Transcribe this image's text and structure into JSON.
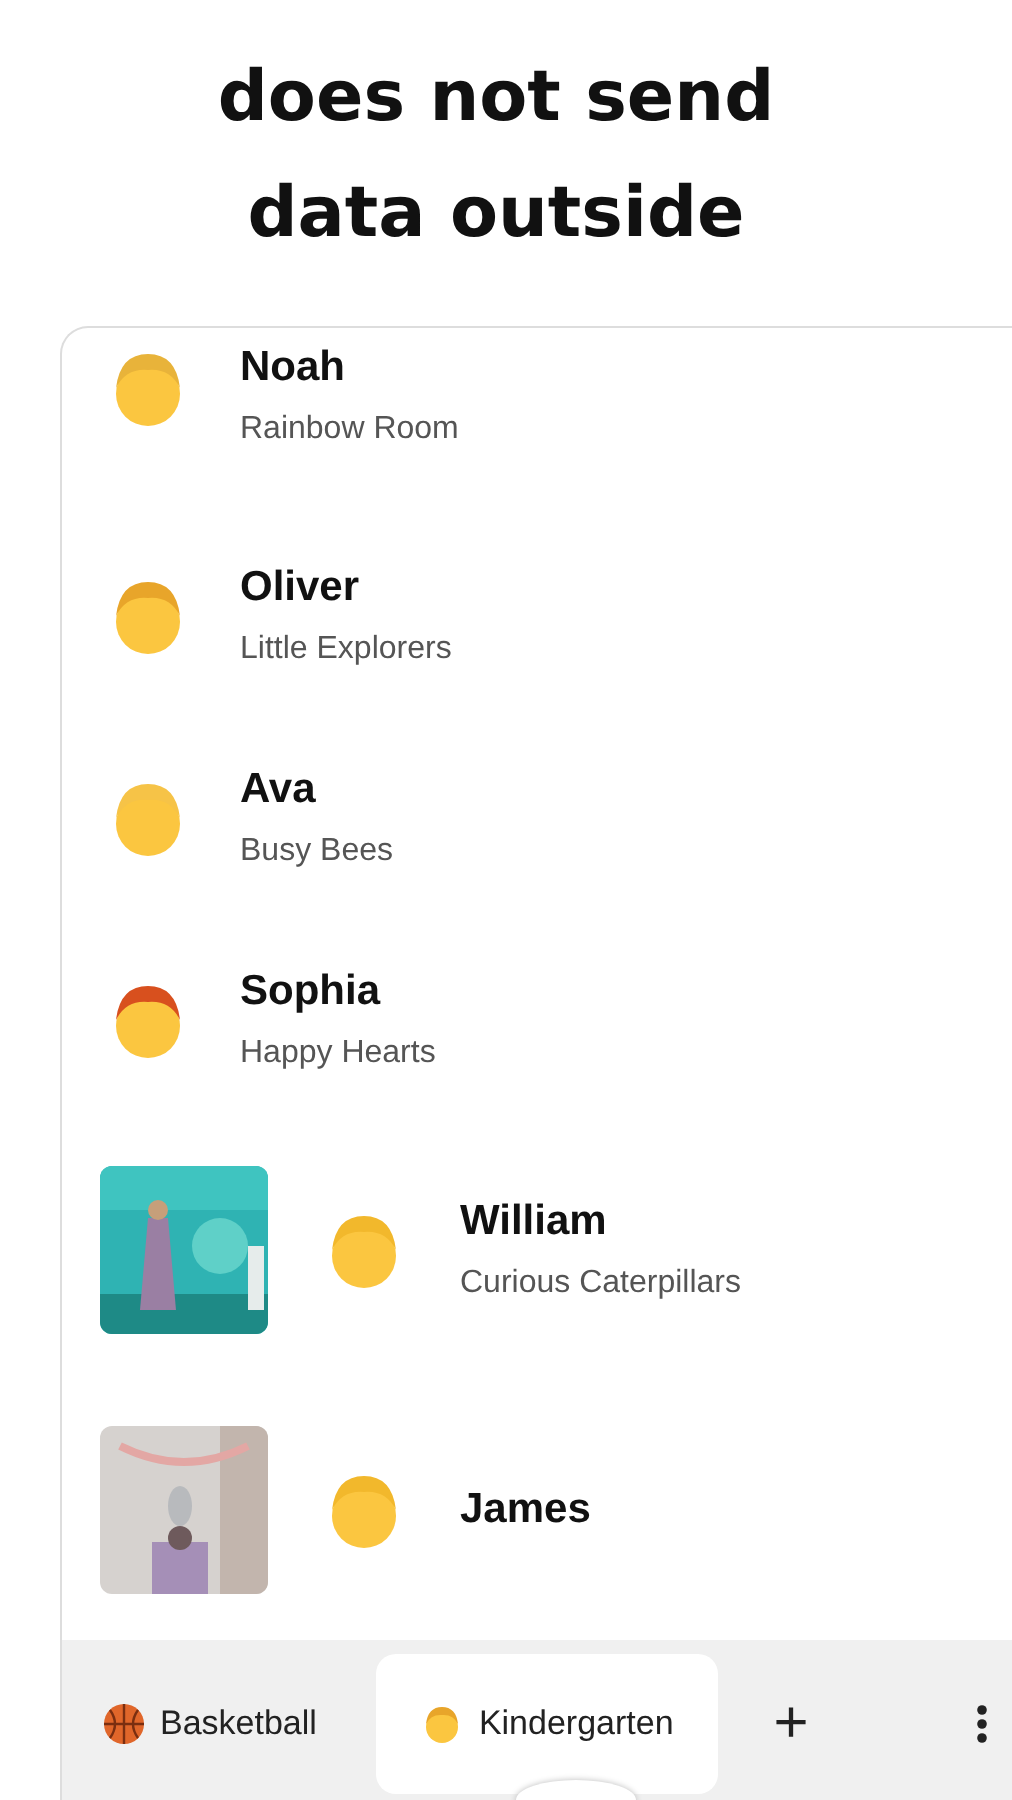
{
  "headline": "does not send\ndata outside",
  "people": [
    {
      "kind": "plain",
      "name": "Noah",
      "group": "Rainbow Room",
      "color": "#e8b33a"
    },
    {
      "kind": "plain",
      "name": "Oliver",
      "group": "Little Explorers",
      "color": "#e8a52a"
    },
    {
      "kind": "plain",
      "name": "Ava",
      "group": "Busy Bees",
      "color": "#f6c347"
    },
    {
      "kind": "plain",
      "name": "Sophia",
      "group": "Happy Hearts",
      "color": "#d8501e"
    },
    {
      "name": "William",
      "group": "Curious Caterpillars",
      "color": "#f2b82c"
    },
    {
      "name": "James",
      "color": "#f2b82c"
    }
  ],
  "tabs": [
    {
      "label": "Basketball",
      "kind": "ball",
      "selected": false
    },
    {
      "label": "Kindergarten",
      "kind": "face",
      "selected": true
    }
  ],
  "add_button": "+"
}
